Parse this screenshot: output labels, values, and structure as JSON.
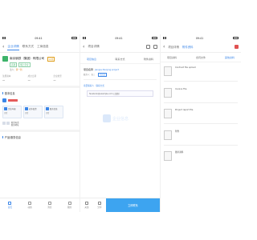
{
  "left": {
    "status": {
      "carrier": "●●●●",
      "time": "09:41",
      "battery": "100%"
    },
    "nav": {
      "back": "‹",
      "tabs": [
        "企业详情",
        "联系方式",
        "工商信息"
      ]
    },
    "company": {
      "name": "南京钢铁（集团）有限公司",
      "badge": "存续",
      "tags": [
        "高新",
        "规上企业"
      ],
      "meta_label": "法人：",
      "meta_value": "黄一新"
    },
    "metrics": [
      {
        "label": "注册资本",
        "value": "—"
      },
      {
        "label": "成立日期",
        "value": "—"
      },
      {
        "label": "企业类型",
        "value": "—"
      }
    ],
    "section_title": "基本信息",
    "cards": [
      {
        "title": "企业年报",
        "sub": "查看"
      },
      {
        "title": "对外投资",
        "sub": "查看"
      },
      {
        "title": "股东信息",
        "sub": "查看"
      }
    ],
    "contacts": [
      "联系电话",
      "联系地址"
    ],
    "section_title_2": "产品/服务信息",
    "bottom_nav": [
      "首页",
      "动态",
      "消息",
      "我的"
    ]
  },
  "middle": {
    "status": {
      "time": "09:41"
    },
    "nav": {
      "back": "‹",
      "title": "项目详情"
    },
    "tabs": [
      "项目信息",
      "联系方式",
      "附件资料"
    ],
    "message": {
      "title": "项目名称",
      "link": "Jiangsu Nanjing project",
      "sub_label": "联系人：",
      "sub_text": "张三",
      "pill": "已认证"
    },
    "star_list_label": "项目联系人 · 联系方式",
    "popup_text": "facebook@example.com 已复制",
    "watermark": "企业信息",
    "actions": [
      {
        "label": "关注"
      },
      {
        "label": "分享"
      }
    ],
    "primary_action": "立即联系"
  },
  "right": {
    "status": {
      "time": "09:41"
    },
    "nav": {
      "back": "‹",
      "items": [
        "项目详情",
        "附件资料"
      ]
    },
    "tabs": [
      "项目资料",
      "合同文件",
      "其他资料"
    ],
    "docs": [
      {
        "text": "Contract file upload"
      },
      {
        "text": "Invoice File"
      },
      {
        "text": "Project report file"
      },
      {
        "text": "附件"
      },
      {
        "text": "图片资料"
      }
    ]
  },
  "colors": {
    "accent": "#3b86e8",
    "green": "#3db36a",
    "danger": "#e05252",
    "primary_button": "#3da4f0"
  }
}
